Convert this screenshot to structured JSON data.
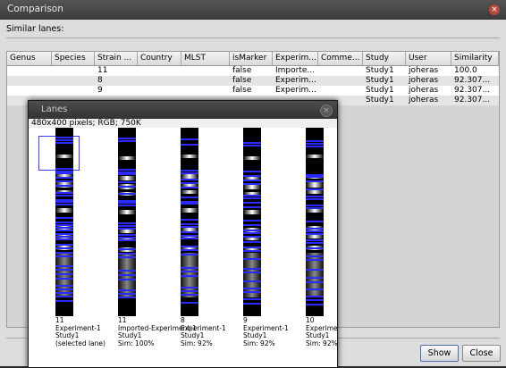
{
  "window": {
    "title": "Comparison",
    "close_glyph": "×"
  },
  "similar_lanes_label": "Similar lanes:",
  "table": {
    "columns": [
      "Genus",
      "Species",
      "Strain ...",
      "Country",
      "MLST",
      "isMarker",
      "Experim...",
      "Comme...",
      "Study",
      "User",
      "Similarity"
    ],
    "rows": [
      [
        "",
        "",
        "11",
        "",
        "",
        "false",
        "Importe...",
        "",
        "Study1",
        "joheras",
        "100.0"
      ],
      [
        "",
        "",
        "8",
        "",
        "",
        "false",
        "Experim...",
        "",
        "Study1",
        "joheras",
        "92.307..."
      ],
      [
        "",
        "",
        "9",
        "",
        "",
        "false",
        "Experim...",
        "",
        "Study1",
        "joheras",
        "92.307..."
      ],
      [
        "",
        "",
        "",
        "",
        "",
        "",
        "",
        "",
        "Study1",
        "joheras",
        "92.307..."
      ]
    ]
  },
  "buttons": {
    "show": "Show",
    "close": "Close"
  },
  "lanes_window": {
    "title": "Lanes",
    "close_glyph": "×",
    "image_info": "480x400 pixels; RGB; 750K",
    "lanes": [
      {
        "lines": [
          "11",
          "Experiment-1",
          "Study1",
          "(selected lane)"
        ]
      },
      {
        "lines": [
          "11",
          "Imported-Experiment-1",
          "Study1",
          "Sim: 100%"
        ]
      },
      {
        "lines": [
          "8",
          "Experiment-1",
          "Study1",
          "Sim: 92%"
        ]
      },
      {
        "lines": [
          "9",
          "Experiment-1",
          "Study1",
          "Sim: 92%"
        ]
      },
      {
        "lines": [
          "10",
          "Experiment",
          "Study1",
          "Sim: 92%"
        ]
      }
    ]
  },
  "colors": {
    "band": "#2a2aff",
    "lane_bg": "#000000"
  }
}
